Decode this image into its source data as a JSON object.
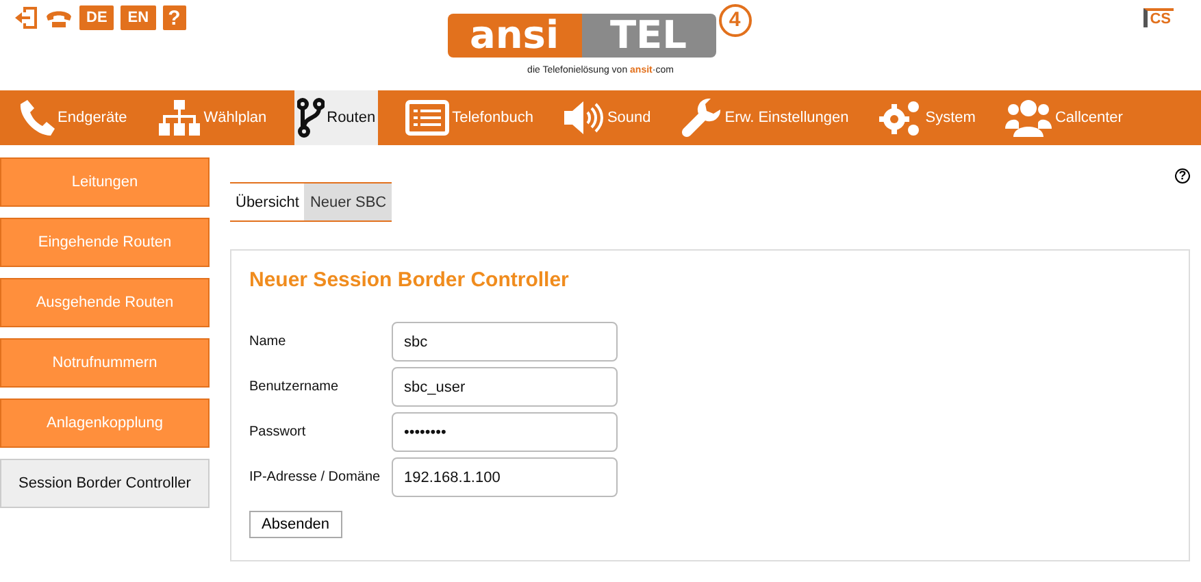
{
  "header": {
    "language_buttons": [
      "DE",
      "EN"
    ],
    "help_button": "?",
    "logo": {
      "part_1": "ansi",
      "part_2": "TEL",
      "version": "4",
      "tagline": "die Telefonielösung von",
      "tagline_brand": "ansit",
      "tagline_suffix": "·com"
    },
    "corner_badge": "CS"
  },
  "nav": [
    {
      "label": "Endgeräte",
      "selected": false
    },
    {
      "label": "Wählplan",
      "selected": false
    },
    {
      "label": "Routen",
      "selected": true
    },
    {
      "label": "Telefonbuch",
      "selected": false
    },
    {
      "label": "Sound",
      "selected": false
    },
    {
      "label": "Erw. Einstellungen",
      "selected": false
    },
    {
      "label": "System",
      "selected": false
    },
    {
      "label": "Callcenter",
      "selected": false
    }
  ],
  "sidebar": [
    {
      "label": "Leitungen",
      "selected": false
    },
    {
      "label": "Eingehende Routen",
      "selected": false
    },
    {
      "label": "Ausgehende Routen",
      "selected": false
    },
    {
      "label": "Notrufnummern",
      "selected": false
    },
    {
      "label": "Anlagenkopplung",
      "selected": false
    },
    {
      "label": "Session Border Controller",
      "selected": true
    }
  ],
  "help_icon": "?",
  "tabs": [
    {
      "label": "Übersicht",
      "selected": false
    },
    {
      "label": "Neuer SBC",
      "selected": true
    }
  ],
  "form": {
    "title": "Neuer Session Border Controller",
    "fields": [
      {
        "label": "Name",
        "value": "sbc"
      },
      {
        "label": "Benutzername",
        "value": "sbc_user"
      },
      {
        "label": "Passwort",
        "value": "••••••••"
      },
      {
        "label": "IP-Adresse / Domäne",
        "value": "192.168.1.100"
      }
    ],
    "submit": "Absenden"
  }
}
